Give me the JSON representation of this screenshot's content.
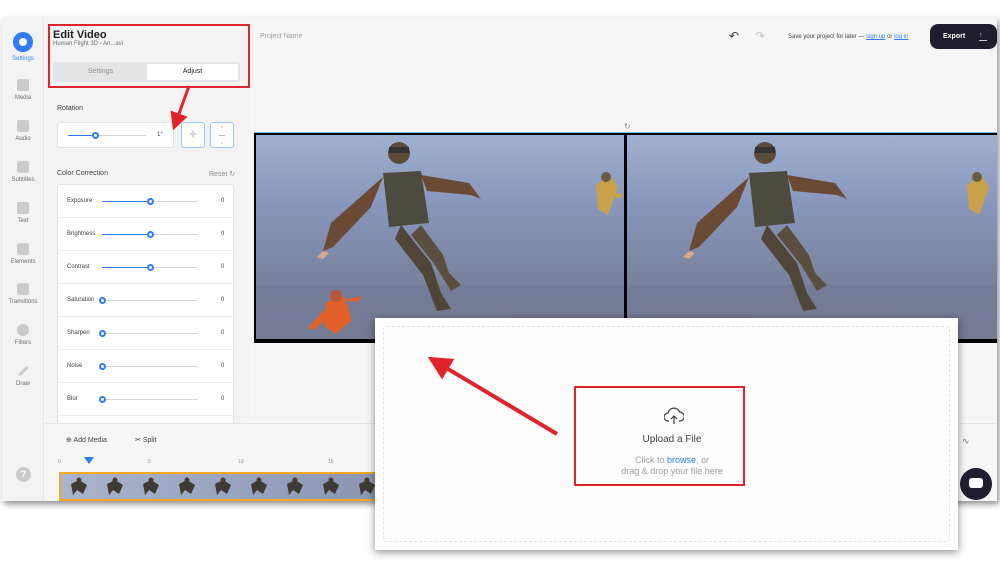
{
  "rail": {
    "items": [
      {
        "label": "Settings",
        "icon": "settings-icon"
      },
      {
        "label": "Media",
        "icon": "media-icon"
      },
      {
        "label": "Audio",
        "icon": "music-note-icon"
      },
      {
        "label": "Subtitles",
        "icon": "subtitles-icon"
      },
      {
        "label": "Text",
        "icon": "text-icon"
      },
      {
        "label": "Elements",
        "icon": "elements-icon"
      },
      {
        "label": "Transitions",
        "icon": "transitions-icon"
      },
      {
        "label": "Filters",
        "icon": "filters-icon"
      },
      {
        "label": "Draw",
        "icon": "pencil-icon"
      }
    ],
    "help": "?"
  },
  "panel": {
    "title": "Edit Video",
    "subtitle": "Human Flight 3D - An...avi",
    "tabs": [
      {
        "label": "Settings",
        "active": false
      },
      {
        "label": "Adjust",
        "active": true
      }
    ],
    "rotation": {
      "label": "Rotation",
      "value": "1°",
      "slider_fraction": 0.35
    },
    "flip_horizontal": "◦|◦",
    "flip_vertical": "◦\n—\n◦",
    "color_correction": {
      "label": "Color Correction",
      "reset": "Reset",
      "rows": [
        {
          "label": "Exposure",
          "value": "0",
          "slider_fraction": 0.5
        },
        {
          "label": "Brightness",
          "value": "0",
          "slider_fraction": 0.5
        },
        {
          "label": "Contrast",
          "value": "0",
          "slider_fraction": 0.5
        },
        {
          "label": "Saturation",
          "value": "0",
          "slider_fraction": 0.0
        },
        {
          "label": "Sharpen",
          "value": "0",
          "slider_fraction": 0.0
        },
        {
          "label": "Noise",
          "value": "0",
          "slider_fraction": 0.0
        },
        {
          "label": "Blur",
          "value": "0",
          "slider_fraction": 0.0
        }
      ]
    }
  },
  "header": {
    "project_name": "Project Name",
    "undo": "↶",
    "redo": "↷",
    "save_prefix": "Save your project for later — ",
    "sign_up": "sign up",
    "or": " or ",
    "log_in": "log in",
    "export": "Export"
  },
  "timeline": {
    "add_media": "Add Media",
    "split": "Split",
    "ticks": [
      "0",
      "5",
      "10",
      "15"
    ]
  },
  "upload": {
    "title": "Upload a File",
    "hint_prefix": "Click to ",
    "browse": "browse",
    "hint_suffix": ", or",
    "hint_line2": "drag & drop your file here"
  },
  "colors": {
    "accent": "#2f7cf6",
    "annotation": "#e0242b",
    "clip_border": "#f5a623",
    "export_bg": "#1d1f2e"
  }
}
